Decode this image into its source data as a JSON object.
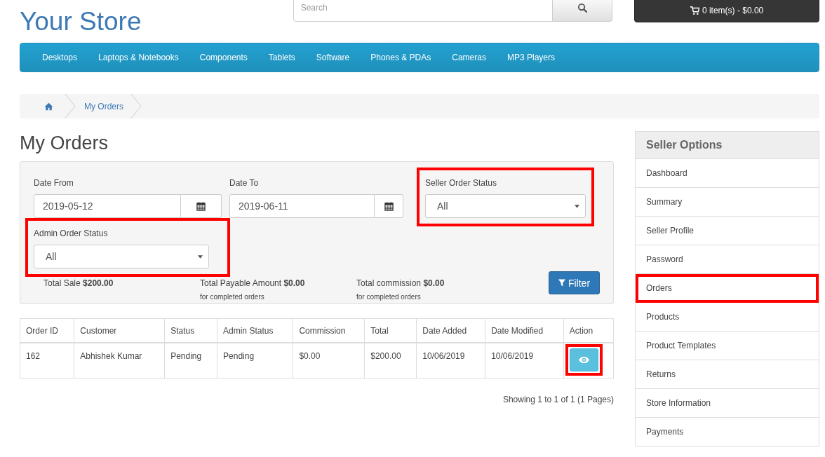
{
  "store_name": "Your Store",
  "search": {
    "placeholder": "Search"
  },
  "cart": {
    "label": "0 item(s) - $0.00"
  },
  "menu": [
    "Desktops",
    "Laptops & Notebooks",
    "Components",
    "Tablets",
    "Software",
    "Phones & PDAs",
    "Cameras",
    "MP3 Players"
  ],
  "breadcrumb": [
    {
      "kind": "home"
    },
    {
      "kind": "link",
      "label": "My Orders"
    }
  ],
  "page_title": "My Orders",
  "filters": [
    {
      "kind": "date",
      "label": "Date From",
      "value": "2019-05-12",
      "highlighted": false
    },
    {
      "kind": "date",
      "label": "Date To",
      "value": "2019-06-11",
      "highlighted": false
    },
    {
      "kind": "select",
      "label": "Seller Order Status",
      "value": "All",
      "highlighted": true
    },
    {
      "kind": "select",
      "label": "Admin Order Status",
      "value": "All",
      "highlighted": true
    }
  ],
  "totals": [
    {
      "text": "Total Sale **$200.00**"
    },
    {
      "text": "Total Payable Amount **$0.00**",
      "note": "for completed orders"
    },
    {
      "text": "Total commission **$0.00**",
      "note": "for completed orders"
    }
  ],
  "filter_button": "Filter",
  "table": {
    "columns": [
      "Order ID",
      "Customer",
      "Status",
      "Admin Status",
      "Commission",
      "Total",
      "Date Added",
      "Date Modified",
      "Action"
    ],
    "rows": [
      {
        "cells": [
          "162",
          "Abhishek Kumar",
          "Pending",
          "Pending",
          "$0.00",
          "$200.00",
          "10/06/2019",
          "10/06/2019"
        ],
        "action_highlighted": true
      }
    ]
  },
  "pagination": "Showing 1 to 1 of 1 (1 Pages)",
  "sidebar": {
    "title": "Seller Options",
    "items": [
      {
        "label": "Dashboard",
        "highlighted": false
      },
      {
        "label": "Summary",
        "highlighted": false
      },
      {
        "label": "Seller Profile",
        "highlighted": false
      },
      {
        "label": "Password",
        "highlighted": false
      },
      {
        "label": "Orders",
        "highlighted": true
      },
      {
        "label": "Products",
        "highlighted": false
      },
      {
        "label": "Product Templates",
        "highlighted": false
      },
      {
        "label": "Returns",
        "highlighted": false
      },
      {
        "label": "Store Information",
        "highlighted": false
      },
      {
        "label": "Payments",
        "highlighted": false
      }
    ]
  }
}
